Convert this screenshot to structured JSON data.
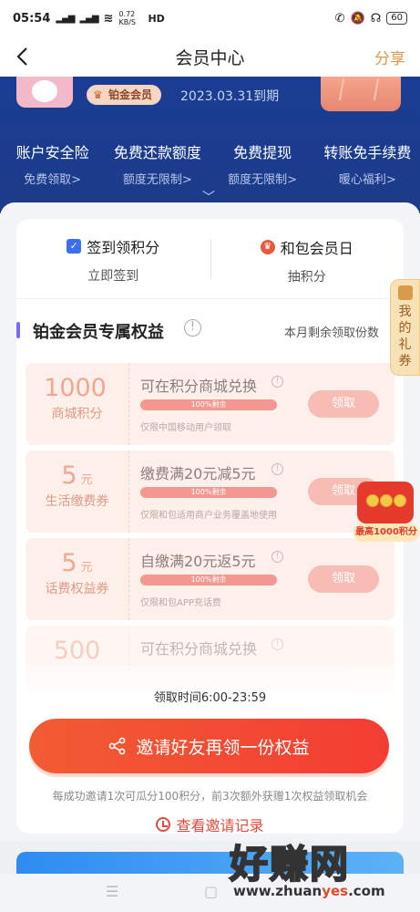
{
  "status_bar": {
    "time": "05:54",
    "net_speed": "0.72 KB/S",
    "net_type": "HD",
    "battery": "60"
  },
  "nav": {
    "title": "会员中心",
    "share": "分享"
  },
  "hero": {
    "tier": "铂金会员",
    "expire": "2023.03.31到期",
    "perks": [
      {
        "title": "账户安全险",
        "sub": "免费领取>"
      },
      {
        "title": "免费还款额度",
        "sub": "额度无限制>"
      },
      {
        "title": "免费提现",
        "sub": "额度无限制>"
      },
      {
        "title": "转账免手续费",
        "sub": "暖心福利>"
      }
    ]
  },
  "sign": [
    {
      "title": "签到领积分",
      "sub": "立即签到"
    },
    {
      "title": "和包会员日",
      "sub": "抽积分"
    }
  ],
  "section": {
    "title": "铂金会员专属权益",
    "right": "本月剩余领取份数"
  },
  "benefits": [
    {
      "num": "1000",
      "num_unit": "",
      "unit": "商城积分",
      "name": "可在积分商城兑换",
      "remaining": "100%剩余",
      "note": "仅限中国移动用户领取",
      "button": "领取"
    },
    {
      "num": "5",
      "num_unit": "元",
      "unit": "生活缴费券",
      "name": "缴费满20元减5元",
      "remaining": "100%剩余",
      "note": "仅限和包适用商户业务覆盖地使用",
      "button": "领取"
    },
    {
      "num": "5",
      "num_unit": "元",
      "unit": "话费权益券",
      "name": "自缴满20元返5元",
      "remaining": "100%剩余",
      "note": "仅限和包APP充话费",
      "button": "领取"
    },
    {
      "num": "500",
      "num_unit": "",
      "unit": "",
      "name": "可在积分商城兑换",
      "remaining": "",
      "note": "",
      "button": ""
    }
  ],
  "claim_time": "领取时间6:00-23:59",
  "invite": {
    "label": "邀请好友再领一份权益",
    "note": "每成功邀请1次可瓜分100积分，前3次额外获赠1次权益领取机会",
    "record": "查看邀请记录"
  },
  "side_tab": {
    "label": [
      "我",
      "的",
      "礼",
      "券"
    ]
  },
  "float_gift": {
    "label": "最高1000积分"
  },
  "watermark": {
    "title": "好赚网",
    "url_prefix": "www.zhuan",
    "url_mid": "yes",
    "url_suffix": ".com"
  }
}
